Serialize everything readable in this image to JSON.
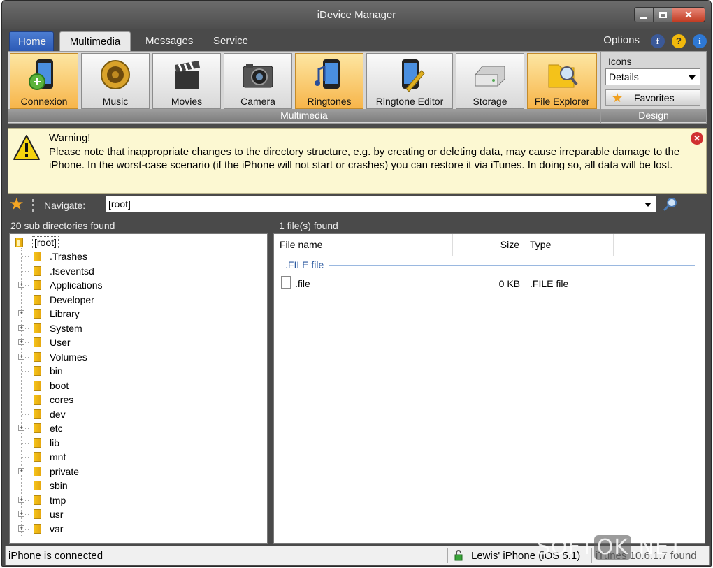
{
  "window": {
    "title": "iDevice Manager"
  },
  "tabs": [
    {
      "label": "Home"
    },
    {
      "label": "Multimedia"
    },
    {
      "label": "Messages"
    },
    {
      "label": "Service"
    }
  ],
  "header_right": {
    "options_label": "Options"
  },
  "ribbon": {
    "buttons": [
      {
        "label": "Connexion",
        "icon": "connexion-phone-icon",
        "highlighted": true
      },
      {
        "label": "Music",
        "icon": "speaker-icon",
        "highlighted": false
      },
      {
        "label": "Movies",
        "icon": "clapperboard-icon",
        "highlighted": false
      },
      {
        "label": "Camera",
        "icon": "camera-icon",
        "highlighted": false
      },
      {
        "label": "Ringtones",
        "icon": "ringtone-phone-icon",
        "highlighted": true
      },
      {
        "label": "Ringtone Editor",
        "icon": "ringtone-editor-icon",
        "highlighted": false
      },
      {
        "label": "Storage",
        "icon": "hard-drive-icon",
        "highlighted": false
      },
      {
        "label": "File Explorer",
        "icon": "folder-search-icon",
        "highlighted": true
      }
    ],
    "group_label": "Multimedia",
    "design": {
      "icons_label": "Icons",
      "view_select": "Details",
      "favorites_label": "Favorites",
      "group_label": "Design"
    }
  },
  "warning": {
    "title": "Warning!",
    "text": "Please note that inappropriate changes to the directory structure, e.g. by creating or deleting data, may cause irreparable damage to the iPhone. In the worst-case scenario (if the iPhone will not start or crashes) you can restore it via iTunes. In doing so, all data will be lost."
  },
  "navigate": {
    "label": "Navigate:",
    "value": "[root]"
  },
  "tree": {
    "count_label": "20 sub directories found",
    "root": "[root]",
    "items": [
      {
        "label": ".Trashes",
        "expandable": false
      },
      {
        "label": ".fseventsd",
        "expandable": false
      },
      {
        "label": "Applications",
        "expandable": true
      },
      {
        "label": "Developer",
        "expandable": false
      },
      {
        "label": "Library",
        "expandable": true
      },
      {
        "label": "System",
        "expandable": true
      },
      {
        "label": "User",
        "expandable": true
      },
      {
        "label": "Volumes",
        "expandable": true
      },
      {
        "label": "bin",
        "expandable": false
      },
      {
        "label": "boot",
        "expandable": false
      },
      {
        "label": "cores",
        "expandable": false
      },
      {
        "label": "dev",
        "expandable": false
      },
      {
        "label": "etc",
        "expandable": true
      },
      {
        "label": "lib",
        "expandable": false
      },
      {
        "label": "mnt",
        "expandable": false
      },
      {
        "label": "private",
        "expandable": true
      },
      {
        "label": "sbin",
        "expandable": false
      },
      {
        "label": "tmp",
        "expandable": true
      },
      {
        "label": "usr",
        "expandable": true
      },
      {
        "label": "var",
        "expandable": true
      }
    ]
  },
  "files": {
    "count_label": "1 file(s) found",
    "columns": [
      "File name",
      "Size",
      "Type"
    ],
    "group": ".FILE file",
    "rows": [
      {
        "name": ".file",
        "size": "0 KB",
        "type": ".FILE file"
      }
    ]
  },
  "status": {
    "connection": "iPhone is connected",
    "device": "Lewis' iPhone (iOS 5.1)",
    "itunes": "iTunes 10.6.1.7 found"
  },
  "watermark": {
    "left": "SOFT",
    "mid": "OK",
    "right": ".NET"
  },
  "colors": {
    "accent": "#2c5ab5",
    "highlight": "#f7b54a",
    "warning_bg": "#fcf8d2"
  }
}
